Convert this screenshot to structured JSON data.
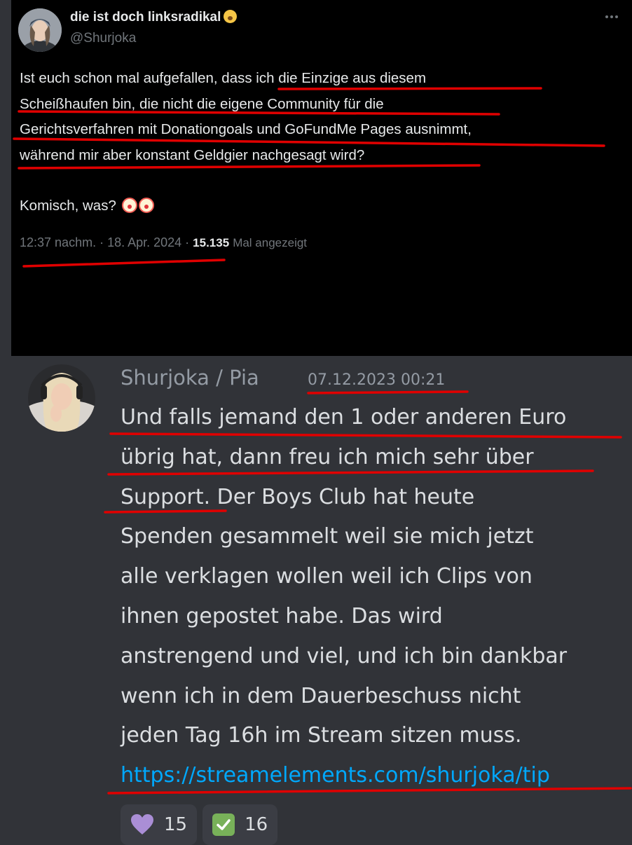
{
  "tweet": {
    "display_name": "die ist doch linksradikal",
    "name_emoji": "flushed-face-icon",
    "handle": "@Shurjoka",
    "text_lines": [
      "Ist euch schon mal aufgefallen, dass ich die Einzige aus diesem",
      "Scheißhaufen bin, die nicht die eigene Community für die",
      "Gerichtsverfahren mit Donationgoals und GoFundMe Pages ausnimmt,",
      "während mir aber konstant Geldgier nachgesagt wird?"
    ],
    "second_paragraph": "Komisch, was?",
    "timestamp": "12:37 nachm. · 18. Apr. 2024 ·",
    "views_count": "15.135",
    "views_label": "Mal angezeigt"
  },
  "discord": {
    "author": "Shurjoka / Pia",
    "timestamp": "07.12.2023 00:21",
    "message_lines": [
      "Und falls jemand den 1 oder anderen Euro",
      "übrig hat, dann freu ich mich sehr über",
      "Support. Der Boys Club hat heute",
      "Spenden gesammelt weil sie mich jetzt",
      "alle verklagen wollen weil ich Clips von",
      "ihnen gepostet habe. Das wird",
      "anstrengend und viel, und ich bin dankbar",
      "wenn ich in dem Dauerbeschuss nicht",
      "jeden Tag 16h im Stream sitzen muss."
    ],
    "link": "https://streamelements.com/shurjoka/tip",
    "reactions": [
      {
        "icon": "purple-heart-icon",
        "count": "15"
      },
      {
        "icon": "check-mark-icon",
        "count": "16"
      }
    ]
  },
  "colors": {
    "tweet_background": "#000000",
    "discord_background": "#313338",
    "link": "#00a8fc",
    "annotation_underline": "#e00000"
  }
}
